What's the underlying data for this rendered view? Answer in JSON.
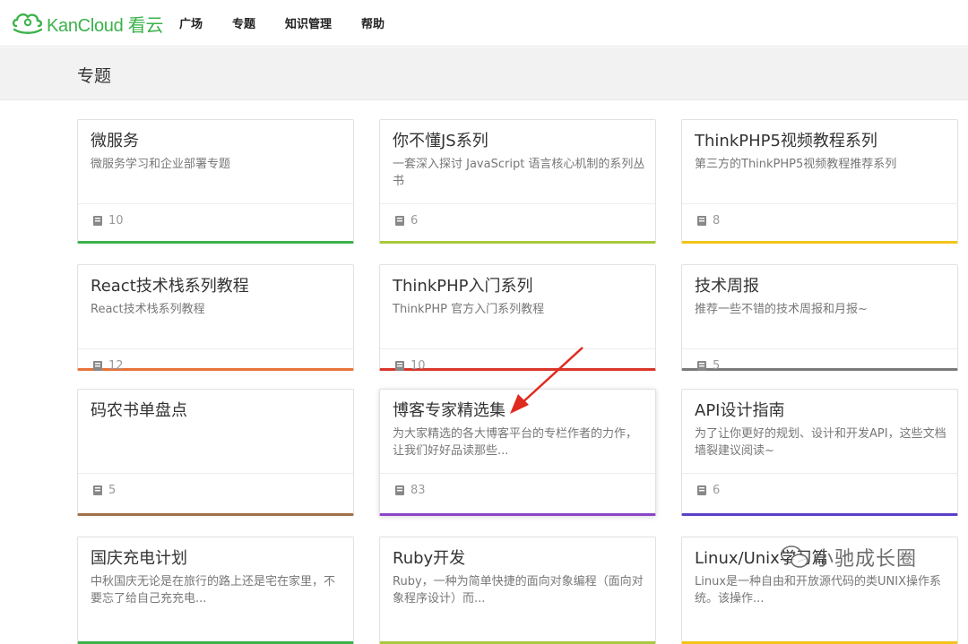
{
  "brand": {
    "logo_text": "KanCloud 看云",
    "color": "#3bb24a"
  },
  "nav": {
    "items": [
      "广场",
      "专题",
      "知识管理",
      "帮助"
    ]
  },
  "banner": {
    "title": "专题"
  },
  "cards": [
    {
      "title": "微服务",
      "desc": "微服务学习和企业部署专题",
      "count": "10",
      "accent": "#3bb24a"
    },
    {
      "title": "你不懂JS系列",
      "desc": "一套深入探讨 JavaScript 语言核心机制的系列丛书",
      "count": "6",
      "accent": "#a8c93c"
    },
    {
      "title": "ThinkPHP5视频教程系列",
      "desc": "第三方的ThinkPHP5视频教程推荐系列",
      "count": "8",
      "accent": "#f2c418"
    },
    {
      "title": "React技术栈系列教程",
      "desc": "React技术栈系列教程",
      "count": "12",
      "accent": "#e8733a"
    },
    {
      "title": "ThinkPHP入门系列",
      "desc": "ThinkPHP 官方入门系列教程",
      "count": "10",
      "accent": "#d9352a"
    },
    {
      "title": "技术周报",
      "desc": "推荐一些不错的技术周报和月报~",
      "count": "5",
      "accent": "#7a7a7a"
    },
    {
      "title": "码农书单盘点",
      "desc": "",
      "count": "5",
      "accent": "#a0714a"
    },
    {
      "title": "博客专家精选集",
      "desc": "为大家精选的各大博客平台的专栏作者的力作，让我们好好品读那些...",
      "count": "83",
      "accent": "#8a45c8"
    },
    {
      "title": "API设计指南",
      "desc": "为了让你更好的规划、设计和开发API，这些文档墙裂建议阅读~",
      "count": "6",
      "accent": "#5b3fc7"
    },
    {
      "title": "国庆充电计划",
      "desc": "中秋国庆无论是在旅行的路上还是宅在家里，不要忘了给自己充充电...",
      "count": "",
      "accent": "#3bb24a"
    },
    {
      "title": "Ruby开发",
      "desc": "Ruby，一种为简单快捷的面向对象编程（面向对象程序设计）而...",
      "count": "",
      "accent": "#a8c93c"
    },
    {
      "title": "Linux/Unix学习篇",
      "desc": "Linux是一种自由和开放源代码的类UNIX操作系统。该操作...",
      "count": "",
      "accent": "#f2c418"
    }
  ],
  "watermark": {
    "text": "小驰成长圈"
  }
}
